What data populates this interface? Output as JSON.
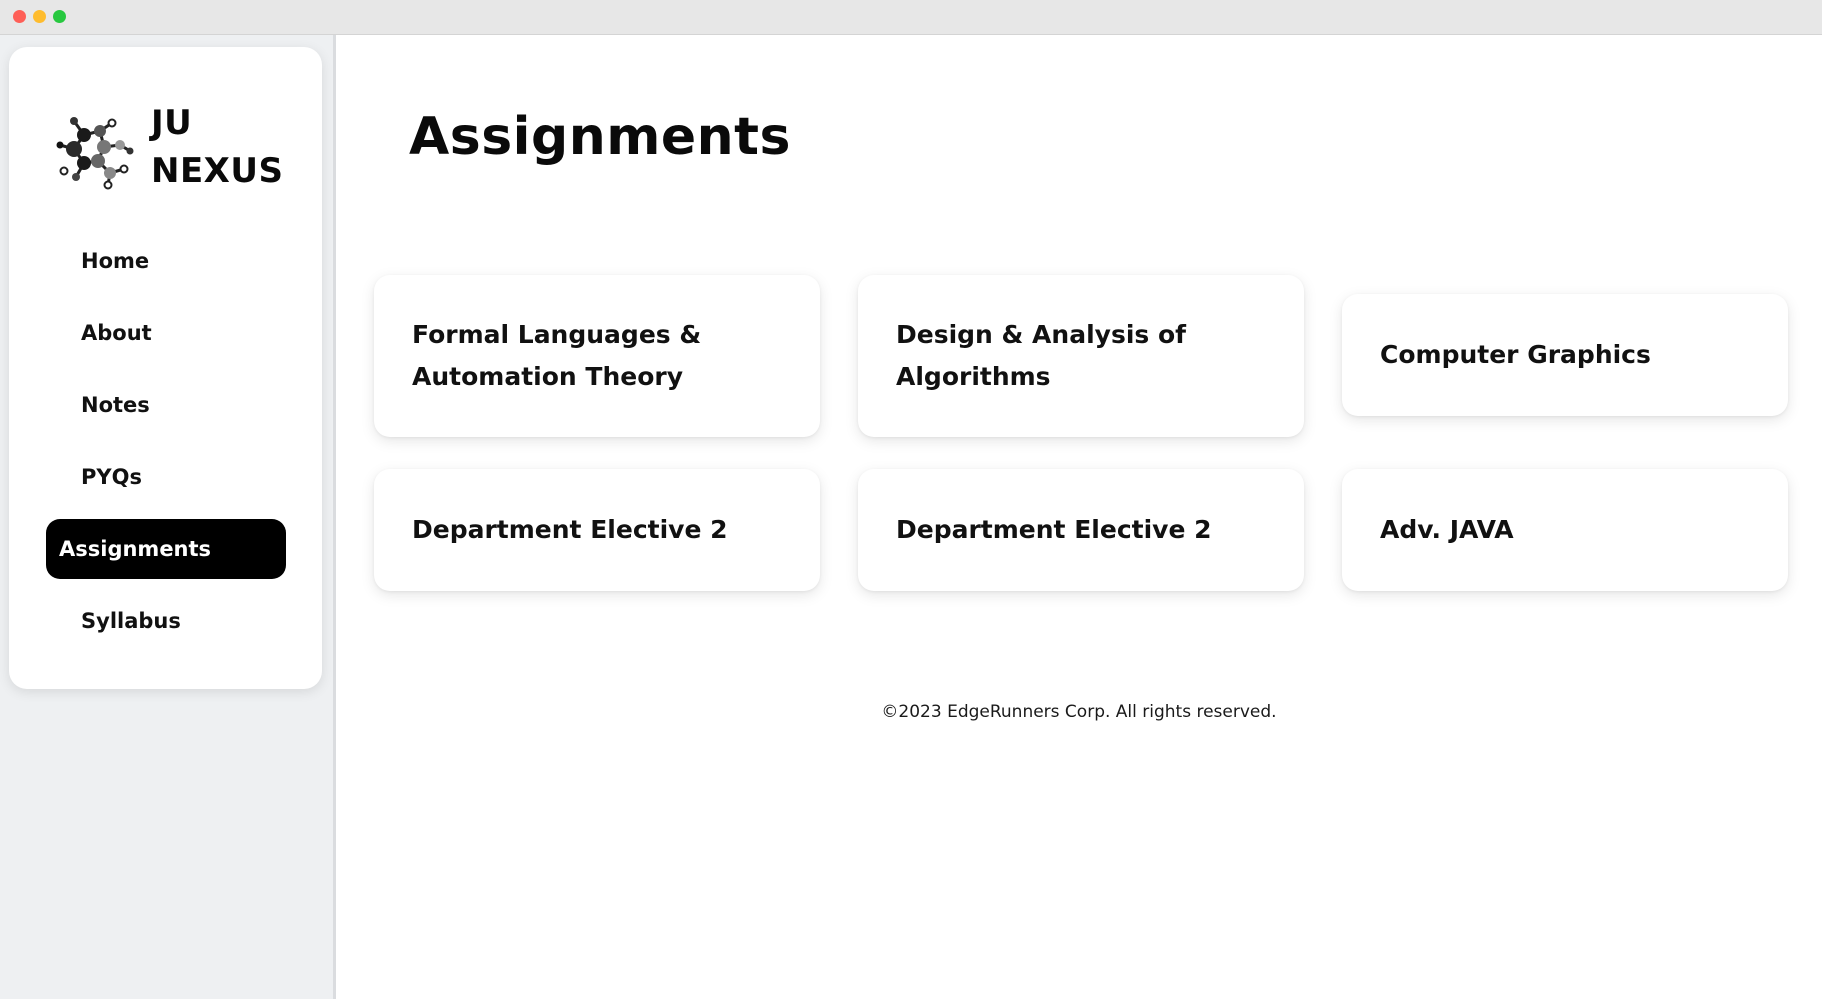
{
  "window": {
    "controls": [
      "close",
      "minimize",
      "maximize"
    ]
  },
  "sidebar": {
    "brand": {
      "line1": "JU",
      "line2": "NEXUS",
      "logo_icon": "molecule-network-icon"
    },
    "items": [
      {
        "label": "Home",
        "active": false
      },
      {
        "label": "About",
        "active": false
      },
      {
        "label": "Notes",
        "active": false
      },
      {
        "label": "PYQs",
        "active": false
      },
      {
        "label": "Assignments",
        "active": true
      },
      {
        "label": "Syllabus",
        "active": false
      }
    ]
  },
  "main": {
    "title": "Assignments",
    "cards": [
      {
        "line1": "Formal Languages &",
        "line2": "Automation Theory"
      },
      {
        "line1": "Design & Analysis of",
        "line2": "Algorithms"
      },
      {
        "line1": "Computer Graphics",
        "line2": ""
      },
      {
        "line1": "Department Elective 2",
        "line2": ""
      },
      {
        "line1": "Department Elective 2",
        "line2": ""
      },
      {
        "line1": "Adv. JAVA",
        "line2": ""
      }
    ]
  },
  "footer": {
    "text": "©2023 EdgeRunners Corp. All rights reserved."
  },
  "colors": {
    "active_bg": "#000000",
    "active_text": "#ffffff",
    "sidebar_bg": "#eef0f2"
  }
}
